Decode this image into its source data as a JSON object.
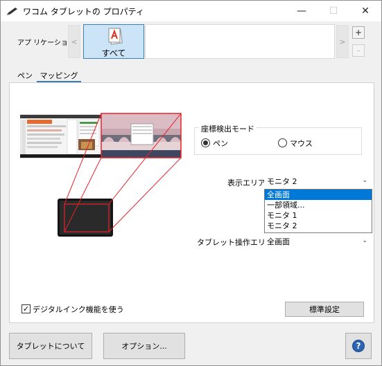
{
  "window": {
    "title": "ワコム タブレットの プロパティ",
    "minimize_glyph": "—",
    "maximize_glyph": "☐",
    "close_glyph": "✕"
  },
  "application": {
    "label": "アプ リケーション:",
    "prev_glyph": "<",
    "next_glyph": ">",
    "selected_tile_label": "すべて",
    "add_glyph": "+",
    "remove_glyph": "-"
  },
  "tabs": [
    {
      "label": "ペン",
      "active": false
    },
    {
      "label": "マッピング",
      "active": true
    }
  ],
  "mapping": {
    "orientation_mode": {
      "title": "座標検出モード",
      "options": [
        {
          "label": "ペン",
          "selected": true
        },
        {
          "label": "マウス",
          "selected": false
        }
      ]
    },
    "display_area": {
      "label": "表示エリア:",
      "value": "モニタ 2",
      "dropdown_open": true,
      "options": [
        "全画面",
        "一部領域...",
        "モニタ 1",
        "モニタ 2"
      ],
      "highlighted_option": "全画面"
    },
    "tablet_area": {
      "label": "タブレット操作エリア:",
      "value": "全画面"
    },
    "digital_ink": {
      "label": "デジタルインク機能を使う",
      "checked": true
    },
    "default_button": "標準設定"
  },
  "footer": {
    "about_button": "タブレットについて",
    "options_button": "オプション...",
    "help_glyph": "?"
  },
  "colors": {
    "accent": "#0078d7",
    "tab_underline": "#3c7fb1",
    "mapping_lines": "#e8202a",
    "selected_tile": "#cce4f7"
  },
  "icons": {
    "app": "tablet-pen-icon",
    "all_apps": "application-sheet-icon",
    "help": "help-icon"
  }
}
